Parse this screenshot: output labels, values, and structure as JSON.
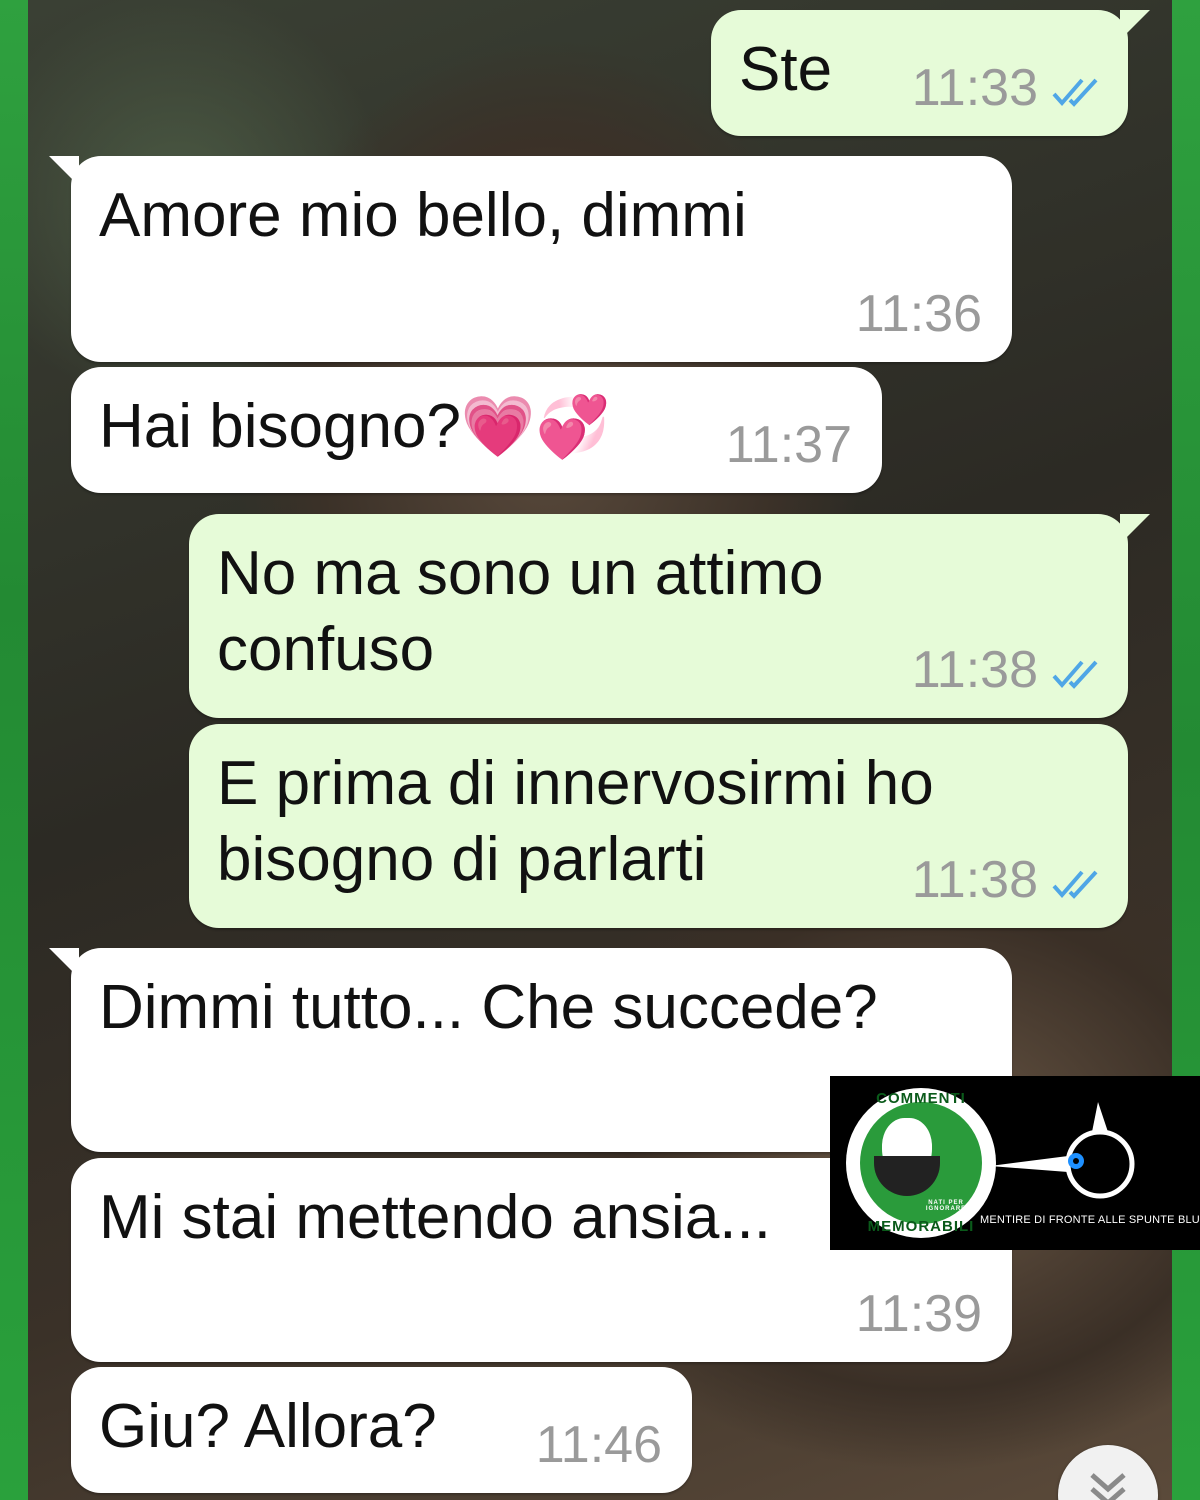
{
  "colors": {
    "incoming_bubble": "#ffffff",
    "outgoing_bubble": "#e6fbd8",
    "timestamp": "#9a9a9a",
    "read_ticks": "#4fa6e6",
    "frame_green": "#2a9b3b"
  },
  "messages": [
    {
      "direction": "outgoing",
      "text": "Ste",
      "time": "11:33",
      "status": "read"
    },
    {
      "direction": "incoming",
      "text": "Amore mio bello, dimmi",
      "time": "11:36"
    },
    {
      "direction": "incoming",
      "text": "Hai bisogno?",
      "emoji": "💗💞",
      "time": "11:37"
    },
    {
      "direction": "outgoing",
      "text": "No ma sono un attimo\nconfuso",
      "time": "11:38",
      "status": "read"
    },
    {
      "direction": "outgoing",
      "text": "E prima di innervosirmi ho\nbisogno di parlarti",
      "time": "11:38",
      "status": "read"
    },
    {
      "direction": "incoming",
      "text": "Dimmi tutto... Che succede?",
      "time": ""
    },
    {
      "direction": "incoming",
      "text": "Mi stai mettendo ansia...",
      "time": "11:39"
    },
    {
      "direction": "incoming",
      "text": "Giu? Allora?",
      "time": "11:46"
    }
  ],
  "watermark": {
    "badge_top": "COMMENTI",
    "badge_bottom": "MEMORABILI",
    "badge_small": "NATI PER IGNORARE",
    "tagline": "MENTIRE DI FRONTE ALLE SPUNTE BLU"
  },
  "scroll_button_icon": "double-chevron-down-icon",
  "read_icon": "double-check-icon"
}
